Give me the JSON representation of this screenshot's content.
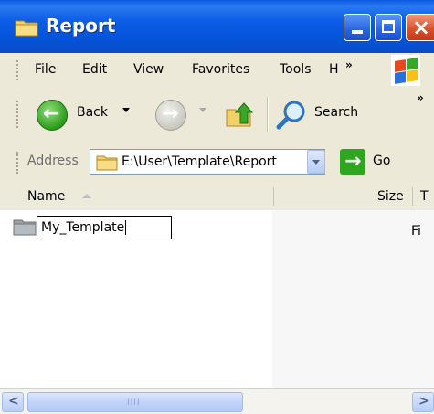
{
  "window": {
    "title": "Report"
  },
  "menu": {
    "items": [
      "File",
      "Edit",
      "View",
      "Favorites",
      "Tools",
      "H"
    ],
    "overflow": "»"
  },
  "toolbar": {
    "back_label": "Back",
    "search_label": "Search",
    "overflow": "»"
  },
  "address": {
    "label": "Address",
    "value": "E:\\User\\Template\\Report",
    "go_label": "Go"
  },
  "columns": {
    "name": "Name",
    "size": "Size",
    "type": "T"
  },
  "files": [
    {
      "name": "My_Template",
      "type": "Fi"
    }
  ],
  "scrollbar": {
    "grip": "IIII"
  },
  "colors": {
    "titlebar": "#0453d8",
    "go_button": "#2ea620",
    "folder": "#f2d06a"
  },
  "icons": [
    "folder-icon",
    "minimize-icon",
    "maximize-icon",
    "close-icon",
    "windows-flag-icon",
    "back-arrow-icon",
    "forward-arrow-icon",
    "up-folder-icon",
    "search-magnifier-icon",
    "go-arrow-icon"
  ]
}
